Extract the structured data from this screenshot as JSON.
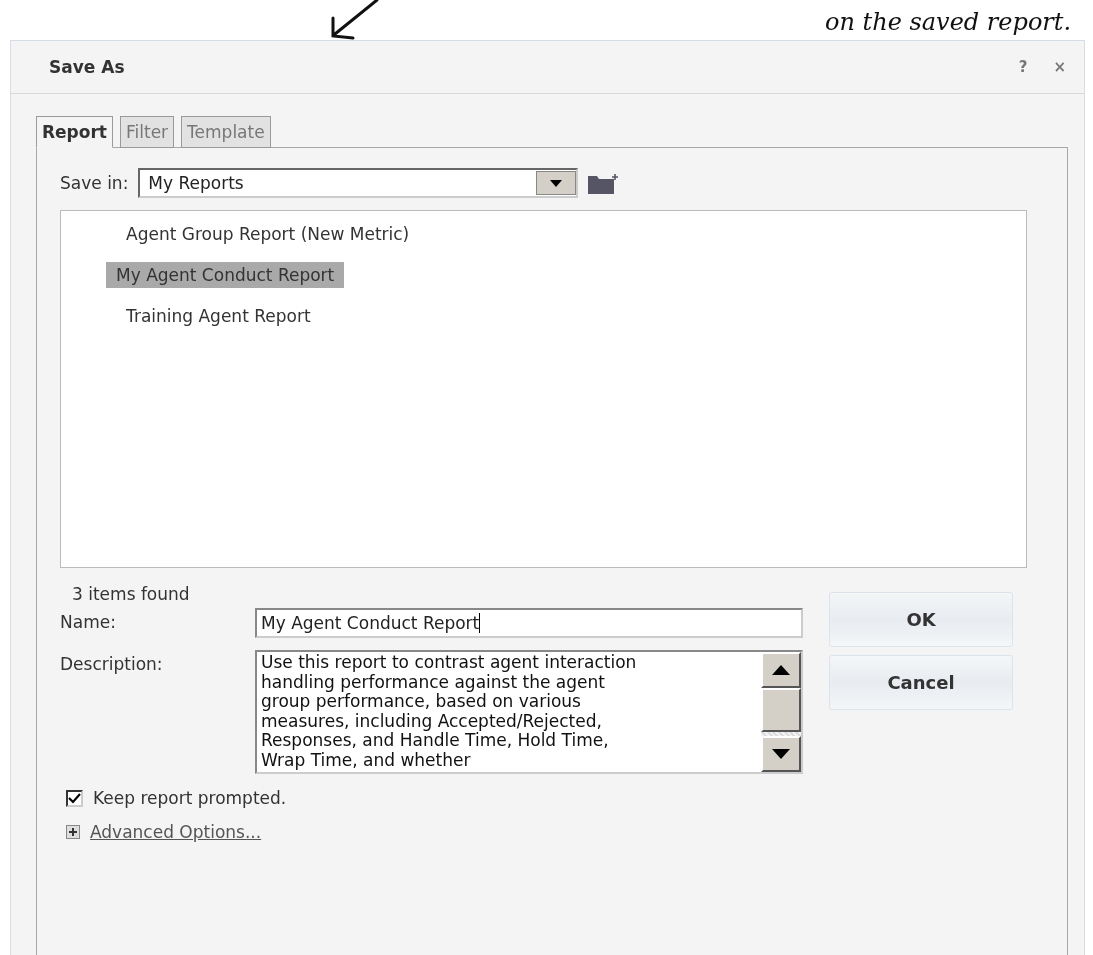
{
  "annotation": {
    "text": "on the saved report."
  },
  "window": {
    "title": "Save As",
    "help": "?",
    "close": "×"
  },
  "tabs": [
    {
      "label": "Report",
      "selected": true
    },
    {
      "label": "Filter",
      "selected": false
    },
    {
      "label": "Template",
      "selected": false
    }
  ],
  "save_in": {
    "label": "Save in:",
    "value": "My Reports"
  },
  "items": [
    {
      "name": "Agent Group Report (New Metric)",
      "selected": false
    },
    {
      "name": "My Agent Conduct Report",
      "selected": true
    },
    {
      "name": "Training Agent Report",
      "selected": false
    }
  ],
  "count": "3 items found",
  "name_field": {
    "label": "Name:",
    "value": "My Agent Conduct Report"
  },
  "description_field": {
    "label": "Description:",
    "value": "Use this report to contrast agent interaction handling performance against the agent group performance, based on various measures, including Accepted/Rejected, Responses, and Handle Time, Hold Time, Wrap Time, and whether"
  },
  "buttons": [
    {
      "label": "OK"
    },
    {
      "label": "Cancel"
    }
  ],
  "keep_prompted": {
    "label": "Keep report prompted.",
    "checked": true
  },
  "advanced": {
    "label": "Advanced Options..."
  }
}
